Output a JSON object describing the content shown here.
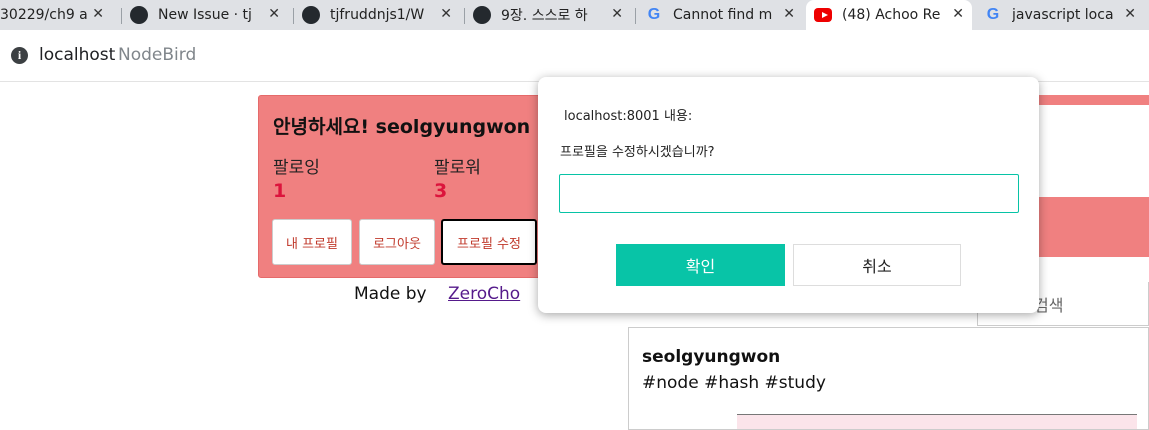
{
  "browser": {
    "tabs": [
      {
        "title": "30229/ch9 a",
        "icon": "none"
      },
      {
        "title": "New Issue · tj",
        "icon": "github-icon"
      },
      {
        "title": "tjfruddnjs1/W",
        "icon": "github-icon"
      },
      {
        "title": "9장. 스스로 하",
        "icon": "github-icon"
      },
      {
        "title": "Cannot find m",
        "icon": "google-icon"
      },
      {
        "title": "(48) Achoo Re",
        "icon": "youtube-icon"
      },
      {
        "title": "javascript loca",
        "icon": "google-icon"
      }
    ],
    "active_tab_index": 5,
    "address": {
      "host": "localhost",
      "page_title": "NodeBird"
    }
  },
  "profile": {
    "greeting": "안녕하세요! seolgyungwon",
    "following_label": "팔로잉",
    "following_count": "1",
    "follower_label": "팔로워",
    "follower_count": "3",
    "buttons": {
      "my_profile": "내 프로필",
      "logout": "로그아웃",
      "edit_profile": "프로필 수정"
    }
  },
  "footer": {
    "made_by": "Made by",
    "author_link": "ZeroCho"
  },
  "sidebar": {
    "search_label": "검색"
  },
  "post": {
    "author": "seolgyungwon",
    "content": "#node #hash #study"
  },
  "dialog": {
    "origin": "localhost:8001 내용:",
    "message": "프로필을 수정하시겠습니까?",
    "input_value": "",
    "ok_label": "확인",
    "cancel_label": "취소"
  },
  "colors": {
    "card_bg": "#f08080",
    "count_color": "#dc143c",
    "ok_button": "#08c4a7"
  }
}
